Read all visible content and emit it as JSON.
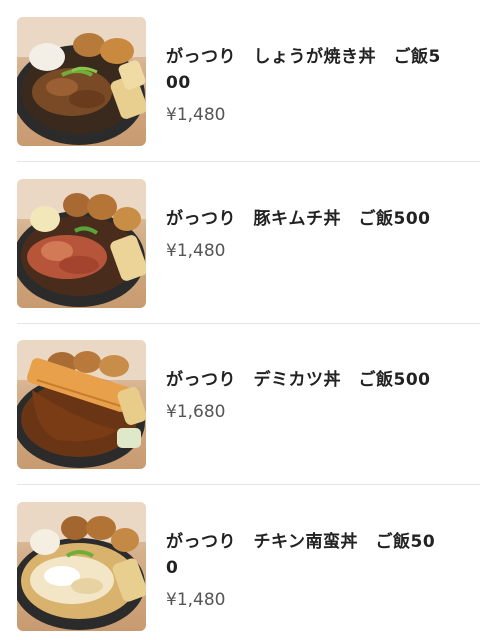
{
  "menu": {
    "items": [
      {
        "name": "がっつり　しょうが焼き丼　ご飯500",
        "price": "¥1,480",
        "image": "ginger-pork-bowl-photo"
      },
      {
        "name": "がっつり　豚キムチ丼　ご飯500",
        "price": "¥1,480",
        "image": "pork-kimchi-bowl-photo"
      },
      {
        "name": "がっつり　デミカツ丼　ご飯500",
        "price": "¥1,680",
        "image": "demi-katsu-bowl-photo"
      },
      {
        "name": "がっつり　チキン南蛮丼　ご飯500",
        "price": "¥1,480",
        "image": "chicken-nanban-bowl-photo"
      }
    ]
  }
}
